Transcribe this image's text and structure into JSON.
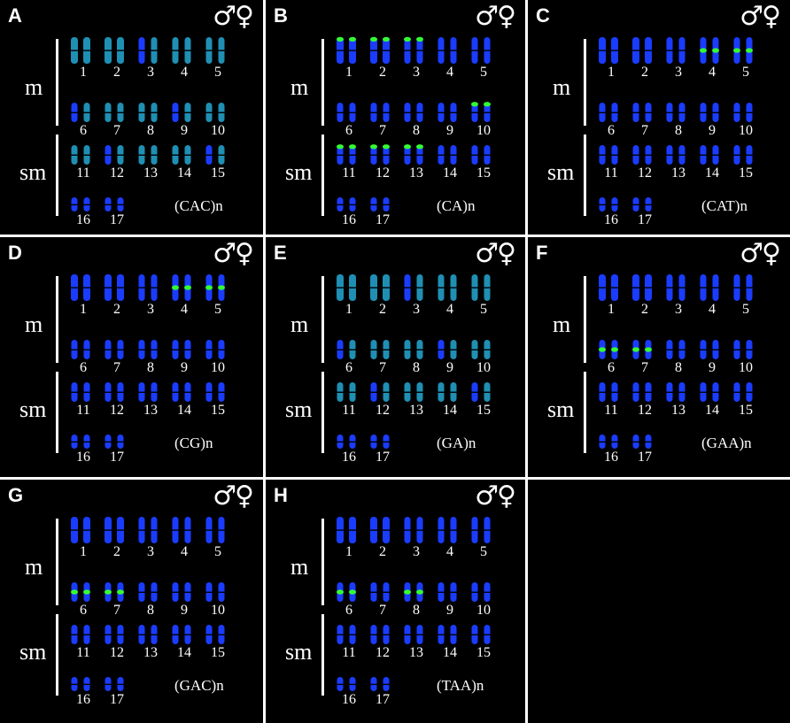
{
  "figure": {
    "sex_symbol": "♂♀",
    "group_labels": {
      "metacentric": "m",
      "submetacentric": "sm"
    },
    "chromosome_numbers": [
      "1",
      "2",
      "3",
      "4",
      "5",
      "6",
      "7",
      "8",
      "9",
      "10",
      "11",
      "12",
      "13",
      "14",
      "15",
      "16",
      "17"
    ],
    "colors": {
      "background": "#000000",
      "dapi_counterstain": "#1a3cff",
      "fish_signal": "#33ff33",
      "text": "#ffffff"
    },
    "panels": [
      {
        "letter": "A",
        "probe": "(CAC)n",
        "signal": "dispersed-weak-green"
      },
      {
        "letter": "B",
        "probe": "(CA)n",
        "signal": "terminal-spots"
      },
      {
        "letter": "C",
        "probe": "(CAT)n",
        "signal": "centromeric-chr4-5"
      },
      {
        "letter": "D",
        "probe": "(CG)n",
        "signal": "centromeric-chr4-5"
      },
      {
        "letter": "E",
        "probe": "(GA)n",
        "signal": "dispersed-weak-green"
      },
      {
        "letter": "F",
        "probe": "(GAA)n",
        "signal": "centromeric-chr6-7"
      },
      {
        "letter": "G",
        "probe": "(GAC)n",
        "signal": "centromeric-chr6-7"
      },
      {
        "letter": "H",
        "probe": "(TAA)n",
        "signal": "centromeric-chr6-8"
      }
    ]
  }
}
